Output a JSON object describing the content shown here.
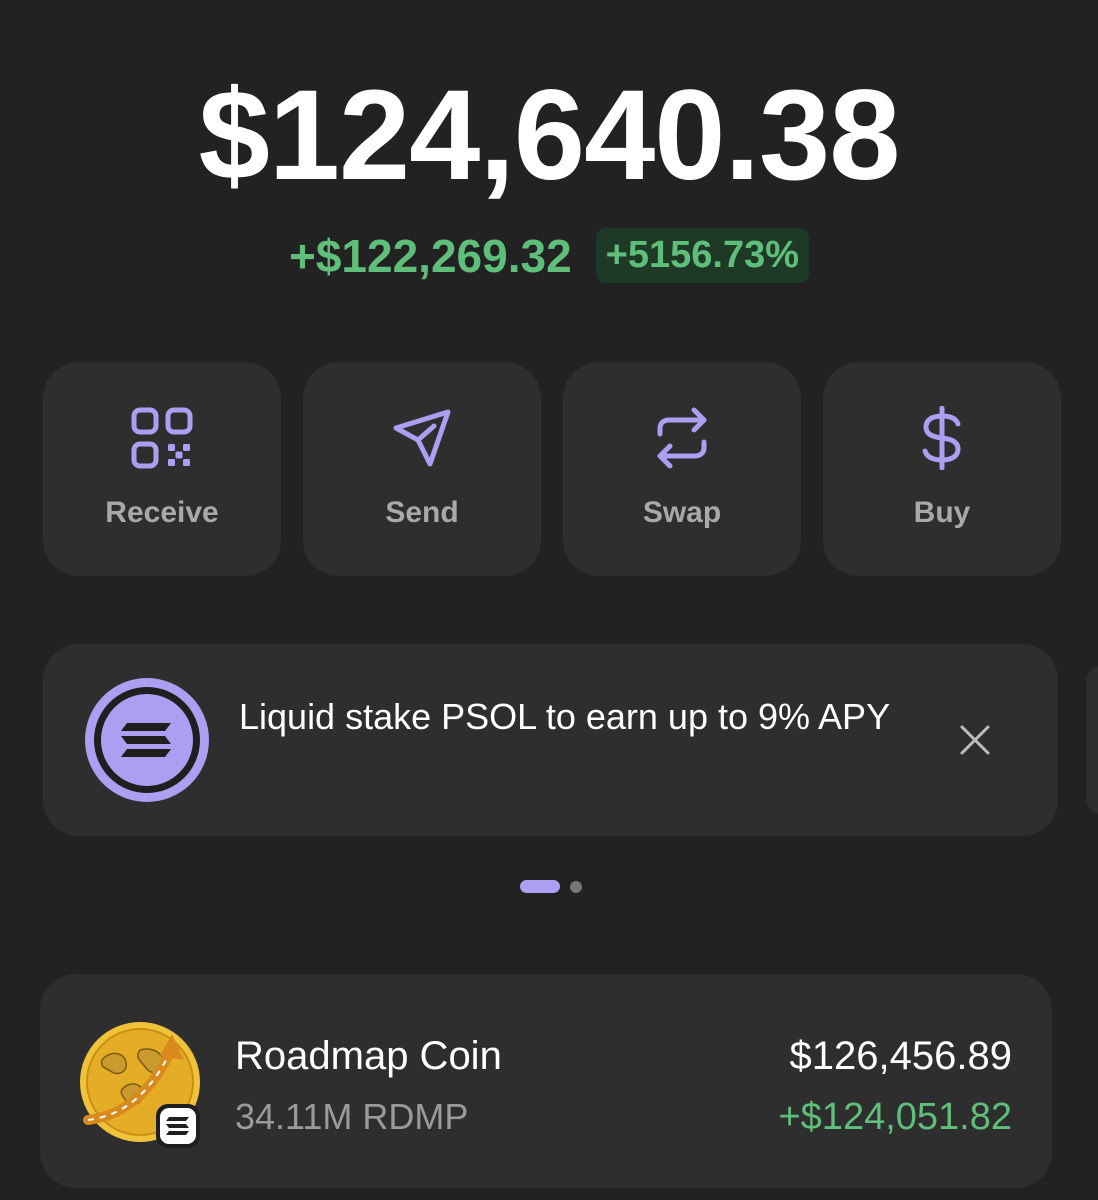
{
  "portfolio": {
    "balance": "$124,640.38",
    "change_amount": "+$122,269.32",
    "change_percent": "+5156.73%"
  },
  "actions": [
    {
      "label": "Receive",
      "icon": "qr-code-icon"
    },
    {
      "label": "Send",
      "icon": "send-icon"
    },
    {
      "label": "Swap",
      "icon": "swap-icon"
    },
    {
      "label": "Buy",
      "icon": "dollar-icon"
    }
  ],
  "banner": {
    "text": "Liquid stake PSOL to earn up to 9% APY",
    "icon": "solana-logo-icon",
    "close_icon": "close-icon"
  },
  "pager": {
    "pages": 2,
    "active_index": 0
  },
  "tokens": [
    {
      "name": "Roadmap Coin",
      "amount": "34.11M RDMP",
      "value": "$126,456.89",
      "change": "+$124,051.82",
      "icon": "roadmap-coin-icon",
      "chain_badge": "solana-badge-icon"
    }
  ],
  "colors": {
    "background": "#222222",
    "card": "#2e2e2e",
    "accent": "#ab9ff2",
    "positive": "#5fbf7a",
    "positive_bg": "#1e3a27",
    "muted_text": "#a9a9a9"
  }
}
